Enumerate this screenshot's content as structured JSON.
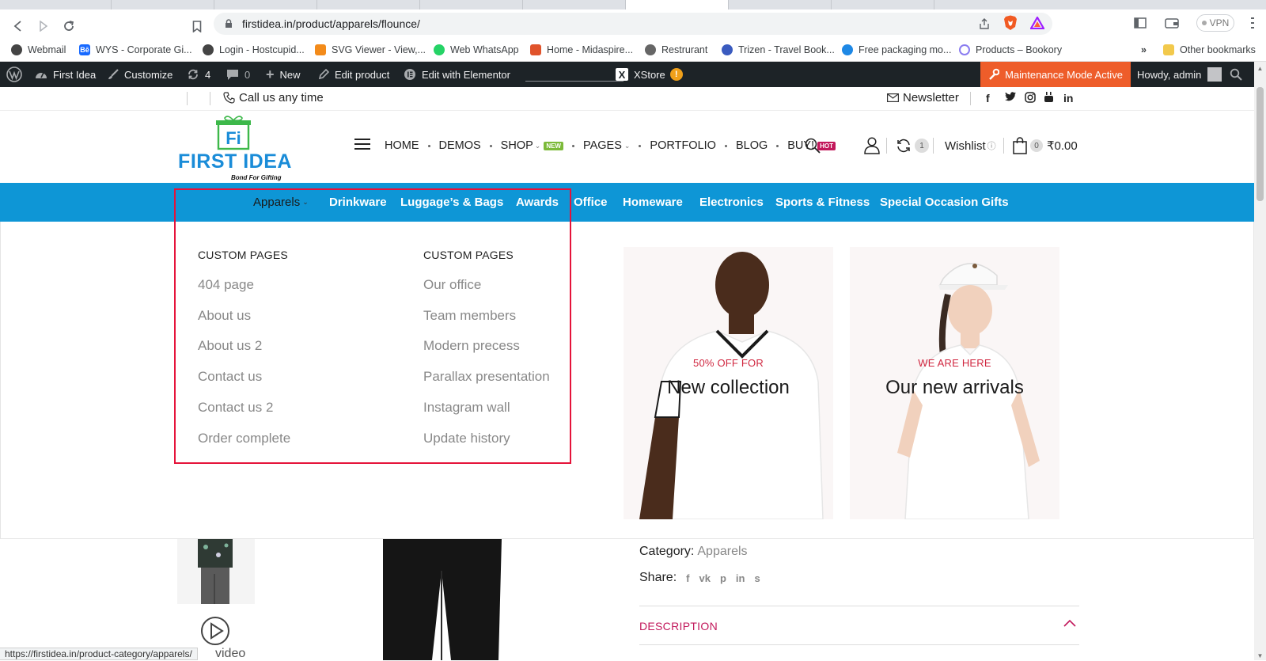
{
  "browser": {
    "url": "firstidea.in/product/apparels/flounce/",
    "vpn_label": "VPN",
    "bookmarks": [
      {
        "label": "Webmail",
        "color": "#444"
      },
      {
        "label": "WYS - Corporate Gi...",
        "color": "#1769ff",
        "glyph": "Bē"
      },
      {
        "label": "Login - Hostcupid...",
        "color": "#444"
      },
      {
        "label": "SVG Viewer - View,...",
        "color": "#f38b1a"
      },
      {
        "label": "Web WhatsApp",
        "color": "#25d366"
      },
      {
        "label": "Home - Midaspire...",
        "color": "#e0532b"
      },
      {
        "label": "Restrurant",
        "color": "#666"
      },
      {
        "label": "Trizen - Travel Book...",
        "color": "#3a5bbf"
      },
      {
        "label": "Free packaging mo...",
        "color": "#1e88e5"
      },
      {
        "label": "Products – Bookory",
        "color": "#8a7cf0"
      }
    ],
    "more_bookmarks": "»",
    "other_bookmarks": "Other bookmarks",
    "status_url": "https://firstidea.in/product-category/apparels/"
  },
  "adminbar": {
    "site_name": "First Idea",
    "customize": "Customize",
    "updates_count": "4",
    "comments_count": "0",
    "new_label": "New",
    "edit_product": "Edit product",
    "edit_elementor": "Edit with Elementor",
    "xstore": "XStore",
    "xstore_alert": "!",
    "maintenance": "Maintenance Mode Active",
    "howdy": "Howdy, admin"
  },
  "topbar": {
    "call": "Call us any time",
    "newsletter": "Newsletter",
    "social": [
      "f",
      "t",
      "ig",
      "yt",
      "in"
    ]
  },
  "header": {
    "logo_text": "FIRST IDEA",
    "logo_tag": "Bond For Gifting",
    "logo_mark": "Fi",
    "nav": [
      {
        "label": "HOME"
      },
      {
        "label": "DEMOS"
      },
      {
        "label": "SHOP",
        "badge": "NEW",
        "caret": true
      },
      {
        "label": "PAGES",
        "caret": true
      },
      {
        "label": "PORTFOLIO"
      },
      {
        "label": "BLOG"
      },
      {
        "label": "BUY!",
        "badge": "HOT"
      }
    ],
    "compare_count": "1",
    "wishlist": "Wishlist",
    "cart_count": "0",
    "cart_total": "₹0.00"
  },
  "categories": [
    {
      "label": "Apparels"
    },
    {
      "label": "Drinkware"
    },
    {
      "label": "Luggage’s & Bags"
    },
    {
      "label": "Awards"
    },
    {
      "label": "Office"
    },
    {
      "label": "Homeware"
    },
    {
      "label": "Electronics"
    },
    {
      "label": "Sports & Fitness"
    },
    {
      "label": "Special Occasion Gifts"
    }
  ],
  "mega": {
    "col1": {
      "heading": "CUSTOM PAGES",
      "links": [
        "404 page",
        "About us",
        "About us 2",
        "Contact us",
        "Contact us 2",
        "Order complete"
      ]
    },
    "col2": {
      "heading": "CUSTOM PAGES",
      "links": [
        "Our office",
        "Team members",
        "Modern precess",
        "Parallax presentation",
        "Instagram wall",
        "Update history"
      ]
    },
    "promos": [
      {
        "kicker": "50% OFF FOR",
        "title": "New collection"
      },
      {
        "kicker": "WE ARE HERE",
        "title": "Our new arrivals"
      }
    ]
  },
  "product": {
    "category_label": "Category:",
    "category_value": "Apparels",
    "share_label": "Share:",
    "share_icons": [
      "f",
      "vk",
      "p",
      "in",
      "s"
    ],
    "description_tab": "DESCRIPTION",
    "video_label": "video"
  },
  "colors": {
    "category_bar": "#0e96d6",
    "admin_bar": "#1d2327",
    "maintenance": "#ee5d2a",
    "highlight_box": "#e5133a",
    "accent_pink": "#c2185b"
  }
}
